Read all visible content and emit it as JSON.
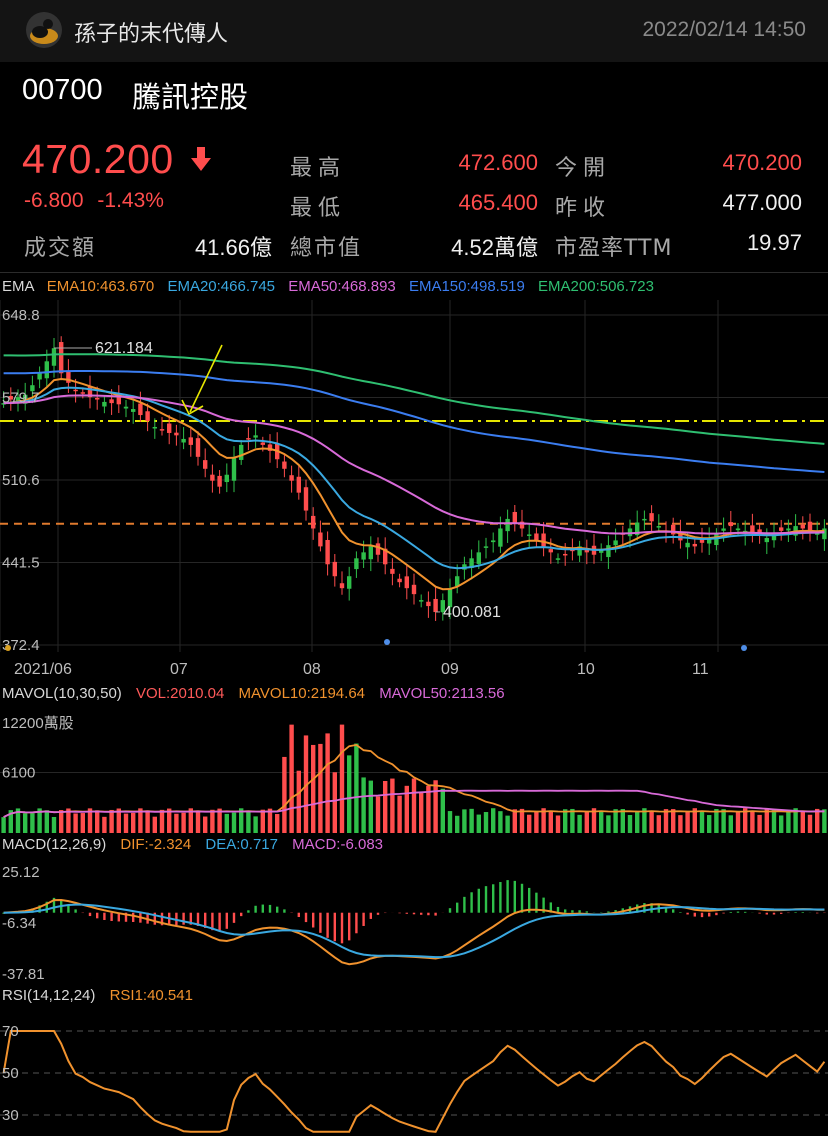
{
  "header": {
    "author": "孫子的末代傳人",
    "timestamp": "2022/02/14 14:50"
  },
  "quote": {
    "code": "00700",
    "name": "騰訊控股",
    "price": "470.200",
    "change": "-6.800",
    "change_pct": "-1.43%",
    "fields": [
      {
        "label": "最高",
        "value": "472.600",
        "color": "#ff4d4d"
      },
      {
        "label": "今開",
        "value": "470.200",
        "color": "#ff4d4d"
      },
      {
        "label": "最低",
        "value": "465.400",
        "color": "#ff4d4d"
      },
      {
        "label": "昨收",
        "value": "477.000",
        "color": "#f0f0f0"
      },
      {
        "label": "成交額",
        "value": "41.66億",
        "color": "#f0f0f0"
      },
      {
        "label": "總市值",
        "value": "4.52萬億",
        "color": "#f0f0f0"
      },
      {
        "label": "市盈率TTM",
        "value": "19.97",
        "color": "#f0f0f0"
      }
    ]
  },
  "ema_legend": {
    "title": "EMA",
    "items": [
      {
        "text": "EMA10:463.670",
        "color": "#f0922e"
      },
      {
        "text": "EMA20:466.745",
        "color": "#3aa8e0"
      },
      {
        "text": "EMA50:468.893",
        "color": "#d86ad8"
      },
      {
        "text": "EMA150:498.519",
        "color": "#3b7df0"
      },
      {
        "text": "EMA200:506.723",
        "color": "#2fbf71"
      }
    ]
  },
  "vol_legend": {
    "items": [
      {
        "text": "MAVOL(10,30,50)",
        "color": "#d8d8d8"
      },
      {
        "text": "VOL:2010.04",
        "color": "#ff5a5a"
      },
      {
        "text": "MAVOL10:2194.64",
        "color": "#f0922e"
      },
      {
        "text": "MAVOL50:2113.56",
        "color": "#d86ad8"
      }
    ]
  },
  "macd_legend": {
    "items": [
      {
        "text": "MACD(12,26,9)",
        "color": "#d8d8d8"
      },
      {
        "text": "DIF:-2.324",
        "color": "#f0922e"
      },
      {
        "text": "DEA:0.717",
        "color": "#3aa8e0"
      },
      {
        "text": "MACD:-6.083",
        "color": "#d86ad8"
      }
    ]
  },
  "rsi_legend": {
    "items": [
      {
        "text": "RSI(14,12,24)",
        "color": "#d8d8d8"
      },
      {
        "text": "RSI1:40.541",
        "color": "#f0922e"
      }
    ]
  },
  "chart_data": [
    {
      "type": "line",
      "panel": "price",
      "y_ticks": [
        "648.8",
        "579.7",
        "510.6",
        "441.5",
        "372.4"
      ],
      "ylim": [
        372.4,
        648.8
      ],
      "x_ticks": [
        "2021/06",
        "07",
        "08",
        "09",
        "10",
        "11"
      ],
      "annotations": [
        "621.184",
        "400.081"
      ],
      "candles_close_approx": [
        575,
        578,
        580,
        582,
        590,
        600,
        610,
        621,
        600,
        592,
        585,
        583,
        580,
        578,
        576,
        575,
        574,
        572,
        570,
        565,
        560,
        555,
        552,
        550,
        548,
        545,
        540,
        530,
        520,
        510,
        505,
        515,
        530,
        540,
        545,
        548,
        540,
        535,
        528,
        520,
        510,
        500,
        485,
        470,
        455,
        440,
        430,
        420,
        430,
        445,
        450,
        455,
        448,
        440,
        432,
        425,
        420,
        415,
        410,
        405,
        400,
        410,
        420,
        430,
        440,
        445,
        450,
        455,
        460,
        470,
        478,
        475,
        470,
        465,
        460,
        455,
        450,
        445,
        448,
        452,
        455,
        450,
        448,
        452,
        456,
        460,
        465,
        470,
        475,
        478,
        476,
        472,
        468,
        465,
        460,
        458,
        455,
        458,
        462,
        466,
        470,
        472,
        470,
        468,
        466,
        464,
        462,
        465,
        468,
        470,
        472,
        470,
        468,
        466,
        470
      ],
      "series": [
        {
          "name": "EMA10",
          "color": "#f0922e"
        },
        {
          "name": "EMA20",
          "color": "#3aa8e0"
        },
        {
          "name": "EMA50",
          "color": "#d86ad8"
        },
        {
          "name": "EMA150",
          "color": "#3b7df0"
        },
        {
          "name": "EMA200",
          "color": "#2fbf71"
        }
      ],
      "h_lines": [
        {
          "value": 560,
          "color": "#e6e600",
          "style": "dashdot"
        },
        {
          "value": 474,
          "color": "#e07a2e",
          "style": "dash"
        }
      ]
    },
    {
      "type": "bar",
      "panel": "volume",
      "y_ticks": [
        "12200萬股",
        "6100"
      ],
      "ylim": [
        0,
        12200
      ]
    },
    {
      "type": "bar",
      "panel": "macd",
      "y_ticks": [
        "25.12",
        "-6.34",
        "-37.81"
      ],
      "ylim": [
        -37.81,
        25.12
      ]
    },
    {
      "type": "line",
      "panel": "rsi",
      "y_ticks": [
        "70",
        "50",
        "30"
      ],
      "ylim": [
        20,
        80
      ]
    }
  ]
}
